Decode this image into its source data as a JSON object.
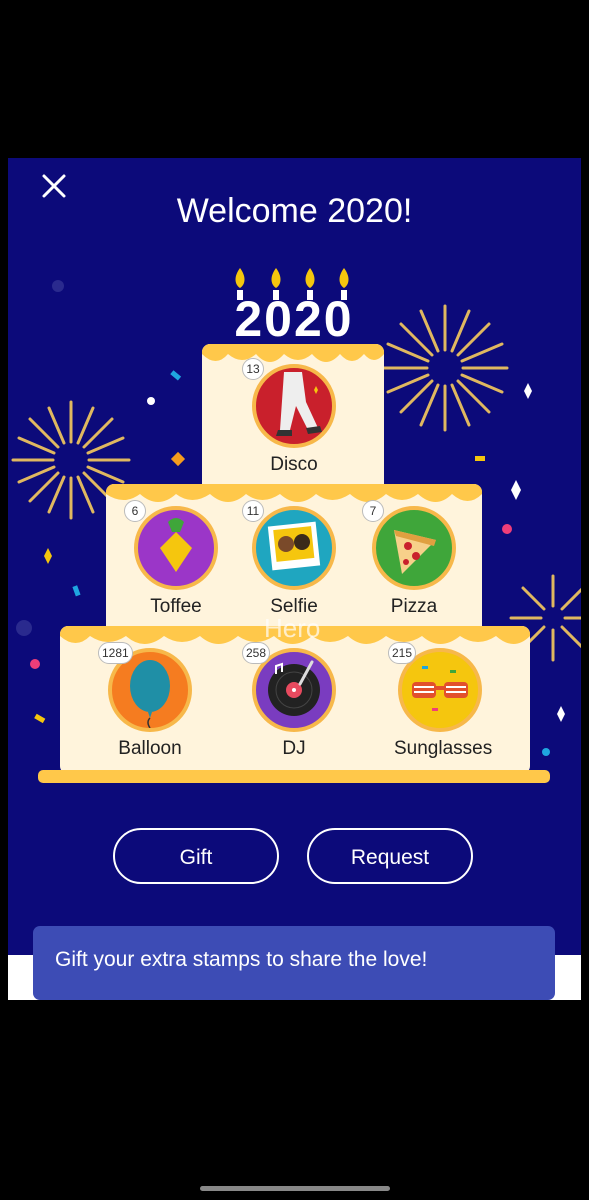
{
  "header": {
    "title": "Welcome 2020!",
    "close_icon": "close-icon"
  },
  "cake": {
    "topper": "2020",
    "overlay_text": "Hero"
  },
  "stamps": [
    {
      "name": "Disco",
      "count": "13"
    },
    {
      "name": "Toffee",
      "count": "6"
    },
    {
      "name": "Selfie",
      "count": "11"
    },
    {
      "name": "Pizza",
      "count": "7"
    },
    {
      "name": "Balloon",
      "count": "1281"
    },
    {
      "name": "DJ",
      "count": "258"
    },
    {
      "name": "Sunglasses",
      "count": "215"
    }
  ],
  "actions": {
    "gift_label": "Gift",
    "request_label": "Request"
  },
  "toast": {
    "message": "Gift your extra stamps to share the love!"
  },
  "colors": {
    "background": "#0c0a7a",
    "cake": "#fff4dc",
    "frosting": "#ffc84a",
    "toast": "#3d4cb5"
  }
}
